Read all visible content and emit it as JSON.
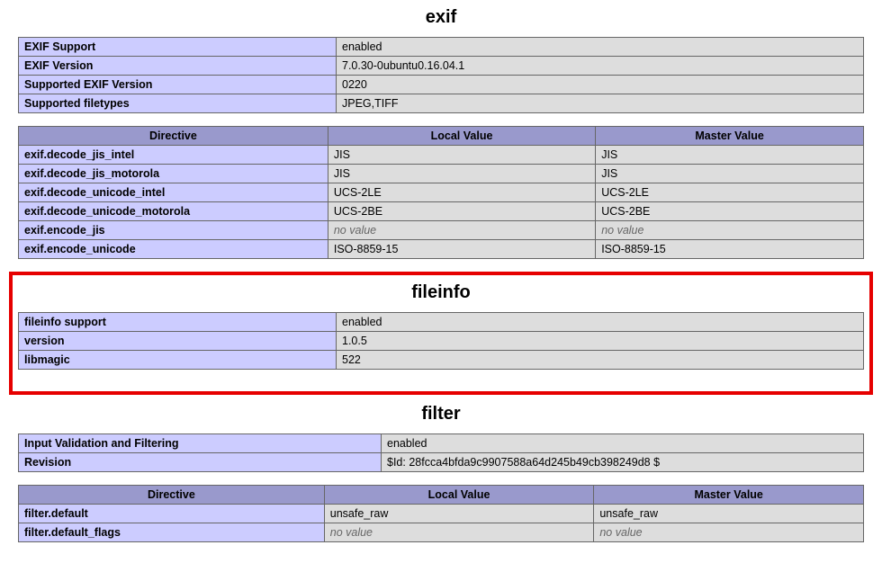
{
  "sections": {
    "exif": {
      "title": "exif",
      "kv": [
        {
          "k": "EXIF Support",
          "v": "enabled"
        },
        {
          "k": "EXIF Version",
          "v": "7.0.30-0ubuntu0.16.04.1"
        },
        {
          "k": "Supported EXIF Version",
          "v": "0220"
        },
        {
          "k": "Supported filetypes",
          "v": "JPEG,TIFF"
        }
      ],
      "directives": {
        "headers": {
          "c0": "Directive",
          "c1": "Local Value",
          "c2": "Master Value"
        },
        "rows": [
          {
            "directive": "exif.decode_jis_intel",
            "local": "JIS",
            "master": "JIS"
          },
          {
            "directive": "exif.decode_jis_motorola",
            "local": "JIS",
            "master": "JIS"
          },
          {
            "directive": "exif.decode_unicode_intel",
            "local": "UCS-2LE",
            "master": "UCS-2LE"
          },
          {
            "directive": "exif.decode_unicode_motorola",
            "local": "UCS-2BE",
            "master": "UCS-2BE"
          },
          {
            "directive": "exif.encode_jis",
            "local": "no value",
            "master": "no value",
            "no_value": true
          },
          {
            "directive": "exif.encode_unicode",
            "local": "ISO-8859-15",
            "master": "ISO-8859-15"
          }
        ]
      }
    },
    "fileinfo": {
      "title": "fileinfo",
      "kv": [
        {
          "k": "fileinfo support",
          "v": "enabled"
        },
        {
          "k": "version",
          "v": "1.0.5"
        },
        {
          "k": "libmagic",
          "v": "522"
        }
      ]
    },
    "filter": {
      "title": "filter",
      "kv": [
        {
          "k": "Input Validation and Filtering",
          "v": "enabled"
        },
        {
          "k": "Revision",
          "v": "$Id: 28fcca4bfda9c9907588a64d245b49cb398249d8 $"
        }
      ],
      "directives": {
        "headers": {
          "c0": "Directive",
          "c1": "Local Value",
          "c2": "Master Value"
        },
        "rows": [
          {
            "directive": "filter.default",
            "local": "unsafe_raw",
            "master": "unsafe_raw"
          },
          {
            "directive": "filter.default_flags",
            "local": "no value",
            "master": "no value",
            "no_value": true
          }
        ]
      }
    }
  }
}
